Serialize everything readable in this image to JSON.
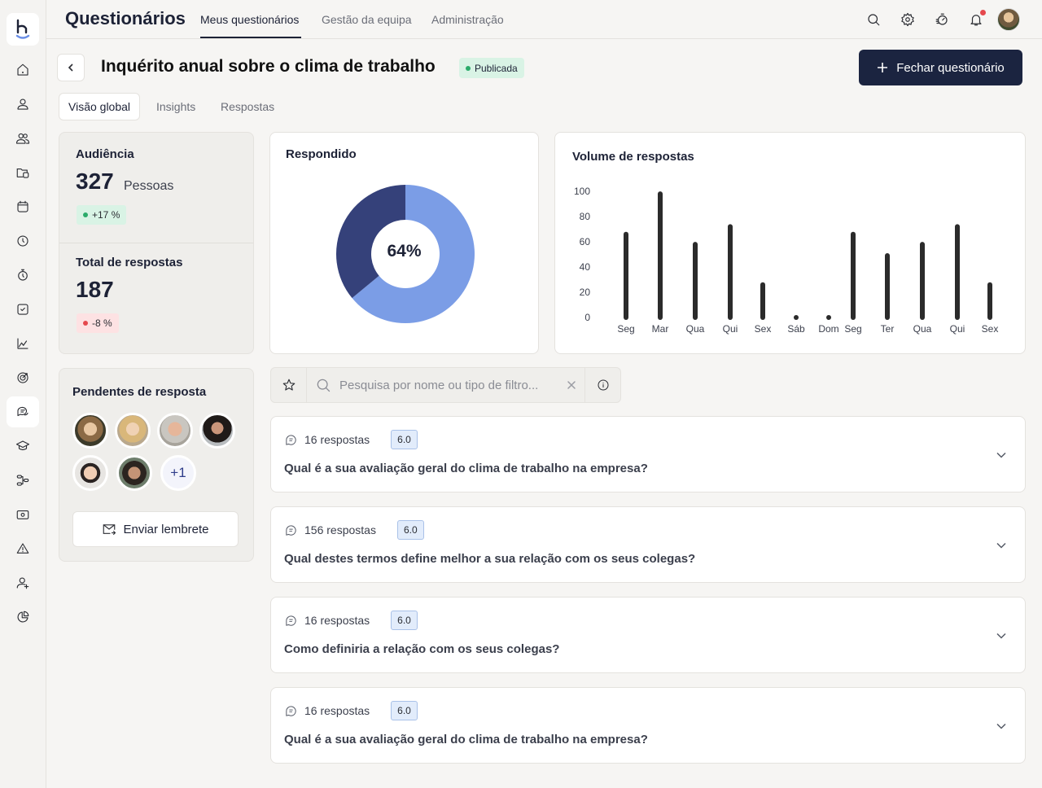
{
  "app": {
    "title": "Questionários"
  },
  "topnav": {
    "tabs": [
      {
        "label": "Meus questionários",
        "active": true
      },
      {
        "label": "Gestão da equipa",
        "active": false
      },
      {
        "label": "Administração",
        "active": false
      }
    ],
    "icons": [
      "search-icon",
      "gear-icon",
      "speedometer-icon",
      "bell-icon",
      "user-avatar"
    ],
    "has_notification": true
  },
  "sidebar": {
    "items": [
      {
        "icon": "home-icon"
      },
      {
        "icon": "user-icon"
      },
      {
        "icon": "users-icon"
      },
      {
        "icon": "folder-user-icon"
      },
      {
        "icon": "calendar-icon"
      },
      {
        "icon": "clock-icon"
      },
      {
        "icon": "stopwatch-icon"
      },
      {
        "icon": "checkbox-icon"
      },
      {
        "icon": "chart-line-icon"
      },
      {
        "icon": "target-icon"
      },
      {
        "icon": "chat-icon",
        "active": true
      },
      {
        "icon": "graduation-cap-icon"
      },
      {
        "icon": "workflow-icon"
      },
      {
        "icon": "money-icon"
      },
      {
        "icon": "warning-icon"
      },
      {
        "icon": "user-plus-icon"
      },
      {
        "icon": "pie-chart-icon"
      }
    ]
  },
  "header": {
    "title": "Inquérito anual sobre o clima de trabalho",
    "status": "Publicada",
    "close_button": "Fechar questionário"
  },
  "subtabs": [
    {
      "label": "Visão global",
      "active": true
    },
    {
      "label": "Insights",
      "active": false
    },
    {
      "label": "Respostas",
      "active": false
    }
  ],
  "stats": {
    "audience": {
      "title": "Audiência",
      "value": "327",
      "unit": "Pessoas",
      "delta": "+17 %"
    },
    "responses": {
      "title": "Total de respostas",
      "value": "187",
      "delta": "-8 %"
    }
  },
  "pending": {
    "title": "Pendentes de resposta",
    "more_count": "+1",
    "remind_button": "Enviar lembrete"
  },
  "colors": {
    "primary": "#1b2440",
    "donut_answered": "#7b9de6",
    "donut_remaining": "#35417a",
    "bar": "#2b2b2b",
    "positive": "#2bab6a",
    "negative": "#e5484d"
  },
  "chart_data": [
    {
      "type": "pie",
      "title": "Respondido",
      "center_label": "64%",
      "values": [
        {
          "label": "Respondido",
          "value": 64
        },
        {
          "label": "Pendente",
          "value": 36
        }
      ]
    },
    {
      "type": "bar",
      "title": "Volume de respostas",
      "categories": [
        "Seg",
        "Mar",
        "Qua",
        "Qui",
        "Sex",
        "Sáb",
        "Dom",
        "Seg",
        "Ter",
        "Qua",
        "Qui",
        "Sex"
      ],
      "values": [
        66,
        98,
        58,
        72,
        26,
        0,
        0,
        66,
        49,
        58,
        72,
        26
      ],
      "yticks": [
        0,
        20,
        40,
        60,
        80,
        100
      ],
      "ylim": [
        0,
        100
      ],
      "xlabel": "",
      "ylabel": "",
      "grid": false
    }
  ],
  "search": {
    "placeholder": "Pesquisa por nome ou tipo de filtro..."
  },
  "questions": [
    {
      "count": "16 respostas",
      "score": "6.0",
      "text": "Qual é a sua avaliação geral do clima de trabalho na empresa?"
    },
    {
      "count": "156 respostas",
      "score": "6.0",
      "text": "Qual destes termos define melhor a sua relação com os seus colegas?"
    },
    {
      "count": "16 respostas",
      "score": "6.0",
      "text": "Como definiria a relação com os seus colegas?"
    },
    {
      "count": "16 respostas",
      "score": "6.0",
      "text": "Qual é a sua avaliação geral do clima de trabalho na empresa?"
    }
  ]
}
